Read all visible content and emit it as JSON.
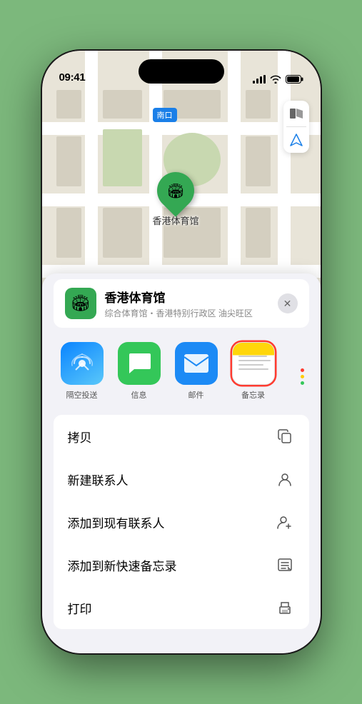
{
  "status_bar": {
    "time": "09:41",
    "location_arrow": "▶"
  },
  "map": {
    "label": "南口",
    "location_name": "香港体育馆",
    "location_sub": "综合体育馆・香港特别行政区 油尖旺区"
  },
  "map_controls": {
    "map_icon": "🗺",
    "location_icon": "◎"
  },
  "share_items": [
    {
      "id": "airdrop",
      "label": "隔空投送"
    },
    {
      "id": "messages",
      "label": "信息"
    },
    {
      "id": "mail",
      "label": "邮件"
    },
    {
      "id": "notes",
      "label": "备忘录"
    }
  ],
  "menu_items": [
    {
      "id": "copy",
      "label": "拷贝",
      "icon": "copy"
    },
    {
      "id": "new-contact",
      "label": "新建联系人",
      "icon": "person"
    },
    {
      "id": "add-to-contact",
      "label": "添加到现有联系人",
      "icon": "person-add"
    },
    {
      "id": "add-to-notes",
      "label": "添加到新快速备忘录",
      "icon": "memo"
    },
    {
      "id": "print",
      "label": "打印",
      "icon": "print"
    }
  ],
  "close_label": "✕"
}
